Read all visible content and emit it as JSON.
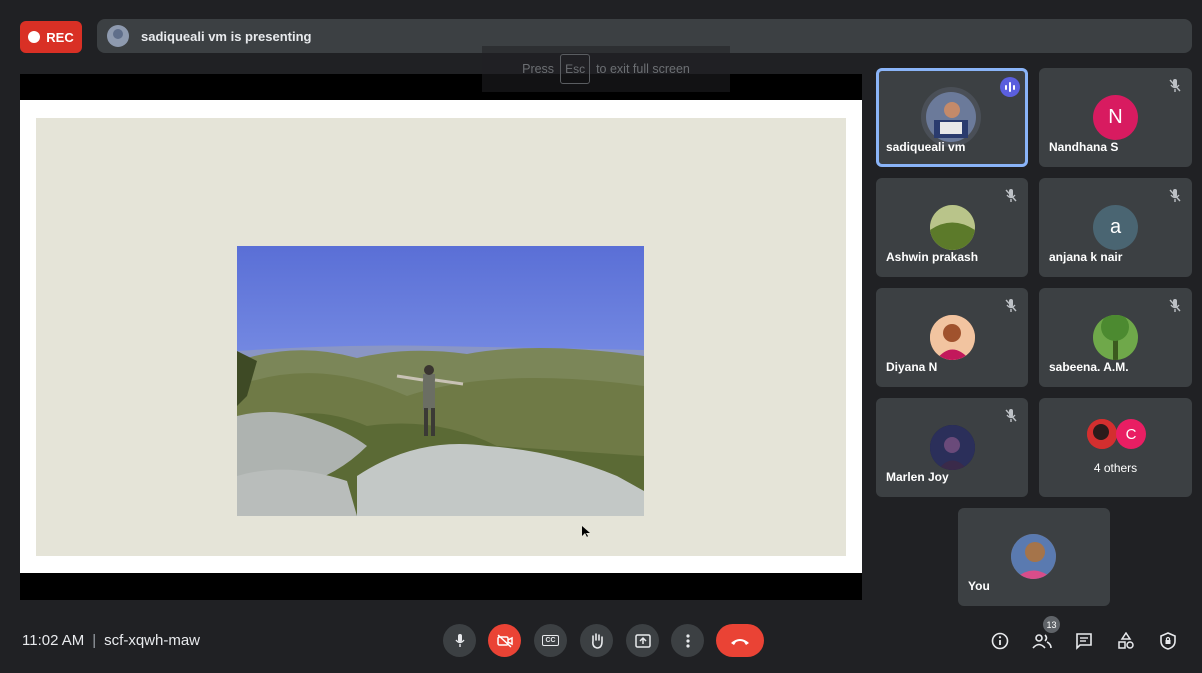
{
  "top_bar": {
    "rec_label": "REC",
    "presenting_text": "sadiqueali vm is presenting"
  },
  "fullscreen_hint": {
    "press": "Press",
    "key": "Esc",
    "rest": "to exit full screen"
  },
  "participants": [
    {
      "name": "sadiqueali vm",
      "speaking": true,
      "avatar": "photo"
    },
    {
      "name": "Nandhana S",
      "muted": true,
      "initial": "N",
      "color": "#d81b60"
    },
    {
      "name": "Ashwin prakash",
      "muted": true,
      "avatar": "photo"
    },
    {
      "name": "anjana k nair",
      "muted": true,
      "initial": "a",
      "color": "#4a6572"
    },
    {
      "name": "Diyana N",
      "muted": true,
      "avatar": "photo"
    },
    {
      "name": "sabeena. A.M.",
      "muted": true,
      "avatar": "photo"
    },
    {
      "name": "Marlen Joy",
      "muted": true,
      "avatar": "photo"
    },
    {
      "name": "4 others",
      "initial": "C",
      "color": "#e91e63"
    },
    {
      "name": "You",
      "avatar": "photo"
    }
  ],
  "meeting": {
    "time": "11:02 AM",
    "separator": "|",
    "code": "scf-xqwh-maw"
  },
  "controls": {
    "mic": "mic-icon",
    "camera": "camera-off-icon",
    "captions_label": "CC",
    "hand": "raise-hand-icon",
    "present": "present-icon",
    "more": "more-vert-icon",
    "end": "end-call-icon"
  },
  "right_controls": {
    "people_count": "13"
  },
  "colors": {
    "rec": "#d93025",
    "end_call": "#ea4335",
    "active_border": "#8ab4f8",
    "speaking": "#5b5fde"
  }
}
